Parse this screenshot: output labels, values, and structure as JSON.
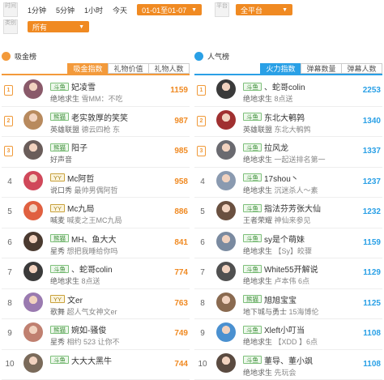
{
  "filters": {
    "time_label": "时间",
    "type_label": "类别",
    "time_tabs": [
      "1分钟",
      "5分钟",
      "1小时",
      "今天"
    ],
    "date_range": "01-01至01-07",
    "platform_label": "平台",
    "platform_value": "全平台",
    "category_value": "所有"
  },
  "left_panel": {
    "title": "吸金榜",
    "icon_color": "#f39a3b",
    "tabs": [
      "吸金指数",
      "礼物价值",
      "礼物人数"
    ],
    "rows": [
      {
        "rank": "1",
        "medal": true,
        "platform": "斗鱼",
        "name": "妃凌雪",
        "game": "绝地求生",
        "desc": "雪MM：不吃",
        "score": "1159",
        "avatar_color": "#8a5a6a"
      },
      {
        "rank": "2",
        "medal": true,
        "platform": "熊猫",
        "name": "老实敦厚的笑笑",
        "game": "英雄联盟",
        "desc": "德云四枪 东",
        "score": "987",
        "avatar_color": "#b88a5e"
      },
      {
        "rank": "3",
        "medal": true,
        "platform": "熊猫",
        "name": "阳子",
        "game": "好声音",
        "desc": "",
        "score": "985",
        "avatar_color": "#6a5d5a"
      },
      {
        "rank": "4",
        "medal": false,
        "platform": "YY",
        "name": "Mc阿哲",
        "game": "说口秀",
        "desc": "最帅男偶阿哲",
        "score": "958",
        "avatar_color": "#d0485a"
      },
      {
        "rank": "5",
        "medal": false,
        "platform": "YY",
        "name": "Mc九局",
        "game": "喊麦",
        "desc": "喊麦之王MC九局",
        "score": "886",
        "avatar_color": "#e06040"
      },
      {
        "rank": "6",
        "medal": false,
        "platform": "熊猫",
        "name": "MH、鱼大大",
        "game": "星秀",
        "desc": "想把我睡给你吗",
        "score": "841",
        "avatar_color": "#4a3a30"
      },
      {
        "rank": "7",
        "medal": false,
        "platform": "斗鱼",
        "name": "、蛇哥colin",
        "game": "绝地求生",
        "desc": "8点送",
        "score": "774",
        "avatar_color": "#3a3a3a"
      },
      {
        "rank": "8",
        "medal": false,
        "platform": "YY",
        "name": "文er",
        "game": "歌舞",
        "desc": "超人气女神文er",
        "score": "763",
        "avatar_color": "#9a7ab0"
      },
      {
        "rank": "9",
        "medal": false,
        "platform": "熊猫",
        "name": "婉如-骚俊",
        "game": "星秀",
        "desc": "相约 523 让你不",
        "score": "749",
        "avatar_color": "#c08070"
      },
      {
        "rank": "10",
        "medal": false,
        "platform": "斗鱼",
        "name": "大大大黑牛",
        "game": "",
        "desc": "",
        "score": "744",
        "avatar_color": "#7a6a5a"
      }
    ]
  },
  "right_panel": {
    "title": "人气榜",
    "icon_color": "#2aa0e6",
    "tabs": [
      "火力指数",
      "弹幕数量",
      "弹幕人数"
    ],
    "rows": [
      {
        "rank": "1",
        "medal": true,
        "platform": "斗鱼",
        "name": "、蛇哥colin",
        "game": "绝地求生",
        "desc": "8点送",
        "score": "2253",
        "avatar_color": "#3a3a3a"
      },
      {
        "rank": "2",
        "medal": true,
        "platform": "斗鱼",
        "name": "东北大鹌鹑",
        "game": "英雄联盟",
        "desc": "东北大鹌鹑",
        "score": "1340",
        "avatar_color": "#a03030"
      },
      {
        "rank": "3",
        "medal": true,
        "platform": "斗鱼",
        "name": "拉风龙",
        "game": "绝地求生",
        "desc": "一起送排名第一",
        "score": "1337",
        "avatar_color": "#6a6a70"
      },
      {
        "rank": "4",
        "medal": false,
        "platform": "斗鱼",
        "name": "17shou丶",
        "game": "绝地求生",
        "desc": "沉迷杀人～素",
        "score": "1237",
        "avatar_color": "#8a9ab0"
      },
      {
        "rank": "5",
        "medal": false,
        "platform": "斗鱼",
        "name": "指法芬芳张大仙",
        "game": "王者荣耀",
        "desc": "神仙来参见",
        "score": "1232",
        "avatar_color": "#6a5040"
      },
      {
        "rank": "6",
        "medal": false,
        "platform": "斗鱼",
        "name": "sy是个萌妹",
        "game": "绝地求生",
        "desc": "【Sy】皎骤",
        "score": "1159",
        "avatar_color": "#7a8aa0"
      },
      {
        "rank": "7",
        "medal": false,
        "platform": "斗鱼",
        "name": "White55开解说",
        "game": "绝地求生",
        "desc": "卢本伟 6点",
        "score": "1129",
        "avatar_color": "#505050"
      },
      {
        "rank": "8",
        "medal": false,
        "platform": "熊猫",
        "name": "旭旭宝宝",
        "game": "地下城与勇士",
        "desc": "15海博伦",
        "score": "1125",
        "avatar_color": "#8a6a50"
      },
      {
        "rank": "9",
        "medal": false,
        "platform": "斗鱼",
        "name": "Xleft小叮当",
        "game": "绝地求生",
        "desc": "【XDD 】6点",
        "score": "1108",
        "avatar_color": "#4a90d0"
      },
      {
        "rank": "10",
        "medal": false,
        "platform": "斗鱼",
        "name": "董导、董小飒",
        "game": "绝地求生",
        "desc": "先玩会",
        "score": "1108",
        "avatar_color": "#5a4a40"
      }
    ]
  }
}
